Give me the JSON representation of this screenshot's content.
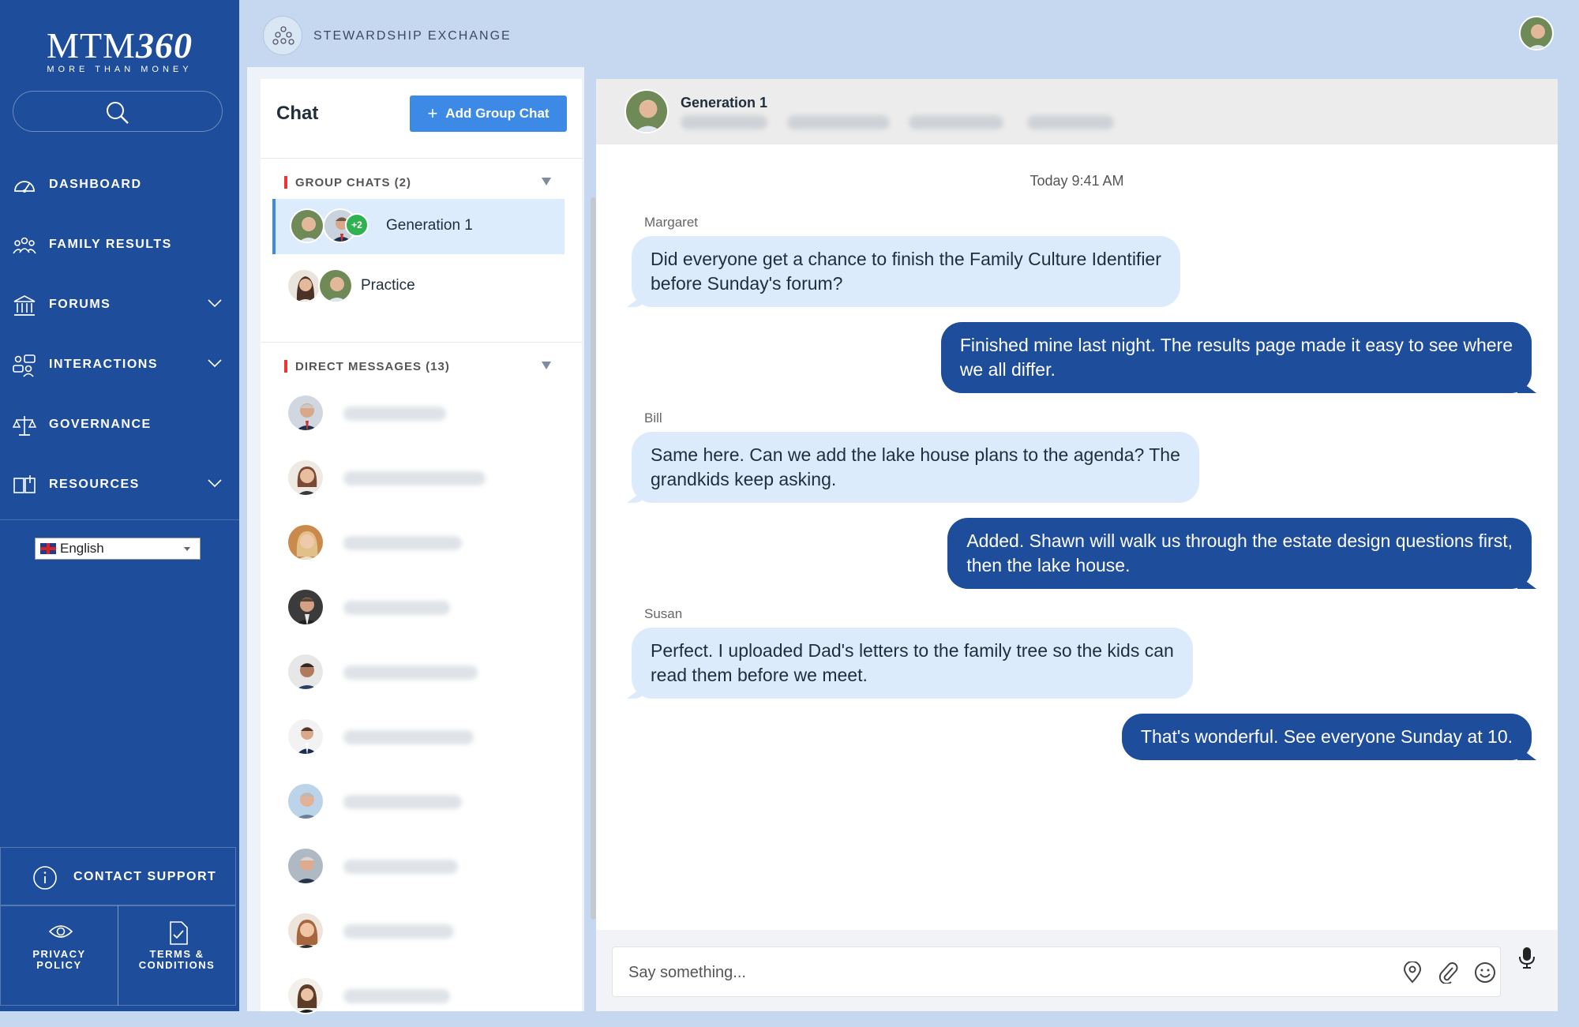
{
  "sidebar": {
    "logo_main": "MTM",
    "logo_num": "360",
    "logo_tagline": "MORE THAN MONEY",
    "nav": [
      {
        "label": "DASHBOARD"
      },
      {
        "label": "FAMILY RESULTS"
      },
      {
        "label": "FORUMS"
      },
      {
        "label": "INTERACTIONS"
      },
      {
        "label": "GOVERNANCE"
      },
      {
        "label": "RESOURCES"
      }
    ],
    "language": "English",
    "contact_support": "CONTACT SUPPORT",
    "privacy_line1": "PRIVACY",
    "privacy_line2": "POLICY",
    "terms_line1": "TERMS &",
    "terms_line2": "CONDITIONS"
  },
  "topbar": {
    "org_name": "STEWARDSHIP EXCHANGE"
  },
  "chat_list": {
    "title": "Chat",
    "add_group_label": "Add Group Chat",
    "group_header": "GROUP CHATS (2)",
    "groups": [
      {
        "name": "Generation 1",
        "extra_count": "+2"
      },
      {
        "name": "Practice"
      }
    ],
    "dm_header": "DIRECT MESSAGES (13)"
  },
  "conversation": {
    "title": "Generation 1",
    "timestamp": "Today 9:41 AM",
    "messages": [
      {
        "sender": "Margaret",
        "text_line1": "Did everyone get a chance to finish the Family Culture Identifier",
        "text_line2": "before Sunday's forum?"
      },
      {
        "text_line1": "Finished mine last night. The results page made it easy to see where",
        "text_line2": "we all differ."
      },
      {
        "sender": "Bill",
        "text_line1": "Same here. Can we add the lake house plans to the agenda? The",
        "text_line2": "grandkids keep asking."
      },
      {
        "text_line1": "Added. Shawn will walk us through the estate design questions first,",
        "text_line2": "then the lake house."
      },
      {
        "sender": "Susan",
        "text_line1": "Perfect. I uploaded Dad's letters to the family tree so the kids can",
        "text_line2": "read them before we meet."
      },
      {
        "text_line1": "That's wonderful. See everyone Sunday at 10."
      }
    ],
    "input_placeholder": "Say something..."
  },
  "colors": {
    "sidebar_bg": "#1e4d9b",
    "accent": "#3d8ae6",
    "incoming_bubble": "#dcebfc",
    "outgoing_bubble": "#1e4d9b",
    "badge_green": "#2fb24f"
  }
}
